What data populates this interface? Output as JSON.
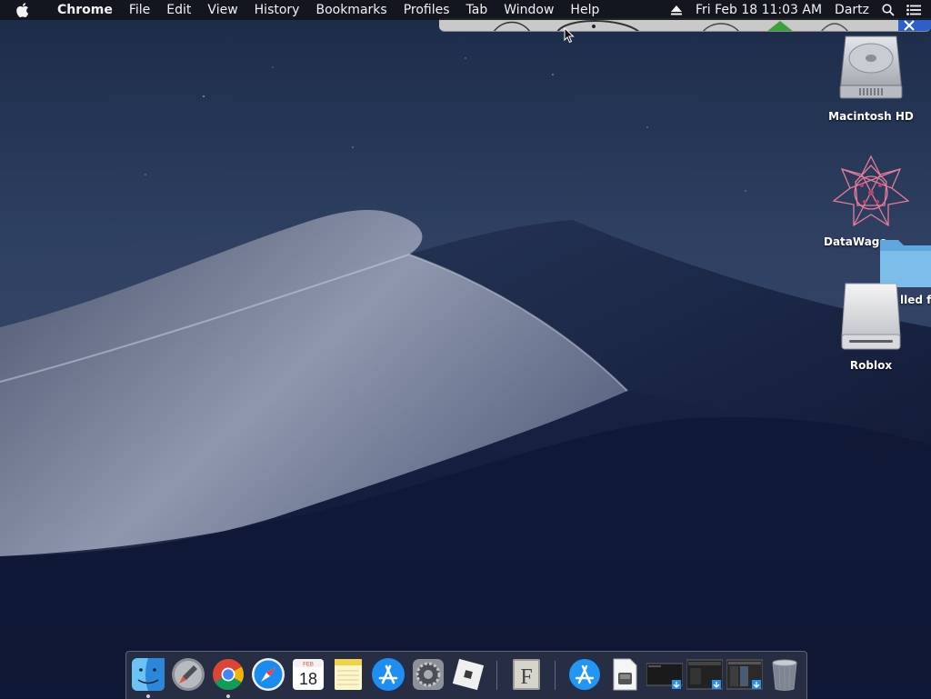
{
  "menubar": {
    "app_name": "Chrome",
    "items": [
      "File",
      "Edit",
      "View",
      "History",
      "Bookmarks",
      "Profiles",
      "Tab",
      "Window",
      "Help"
    ],
    "clock": "Fri Feb 18  11:03 AM",
    "user": "Dartz",
    "icons": [
      "apple-icon",
      "eject-icon",
      "spotlight-search-icon",
      "notification-center-icon"
    ]
  },
  "desktop": {
    "icons": [
      {
        "label": "Macintosh HD",
        "icon": "hard-drive-icon"
      },
      {
        "label": "DataWago",
        "icon": "datawagon-app-icon"
      },
      {
        "label": "lled f",
        "icon": "folder-icon"
      },
      {
        "label": "Roblox",
        "icon": "disk-image-icon"
      }
    ]
  },
  "dock": {
    "items": [
      {
        "icon": "finder-icon",
        "running": true
      },
      {
        "icon": "launchpad-icon",
        "running": false
      },
      {
        "icon": "chrome-icon",
        "running": true
      },
      {
        "icon": "safari-icon",
        "running": false
      },
      {
        "icon": "calendar-icon",
        "running": false,
        "month": "FEB",
        "day": "18"
      },
      {
        "icon": "notes-icon",
        "running": false
      },
      {
        "icon": "app-store-icon",
        "running": false
      },
      {
        "icon": "system-preferences-icon",
        "running": false
      },
      {
        "icon": "roblox-icon",
        "running": false
      },
      {
        "icon": "font-book-icon",
        "running": false,
        "glyph": "F"
      },
      {
        "icon": "app-store-download-icon",
        "running": false
      },
      {
        "icon": "document-icon",
        "running": false
      },
      {
        "icon": "screenshot-thumbnail-1-icon",
        "running": false
      },
      {
        "icon": "screenshot-thumbnail-2-icon",
        "running": false
      },
      {
        "icon": "screenshot-thumbnail-3-icon",
        "running": false
      },
      {
        "icon": "trash-icon",
        "running": false
      }
    ]
  },
  "colors": {
    "menubar_bg": "#12141c",
    "sky_top": "#1b2a47",
    "sky_bottom": "#0f1834",
    "dune_light": "#8e97ad",
    "dock_bg": "#3c404e"
  }
}
